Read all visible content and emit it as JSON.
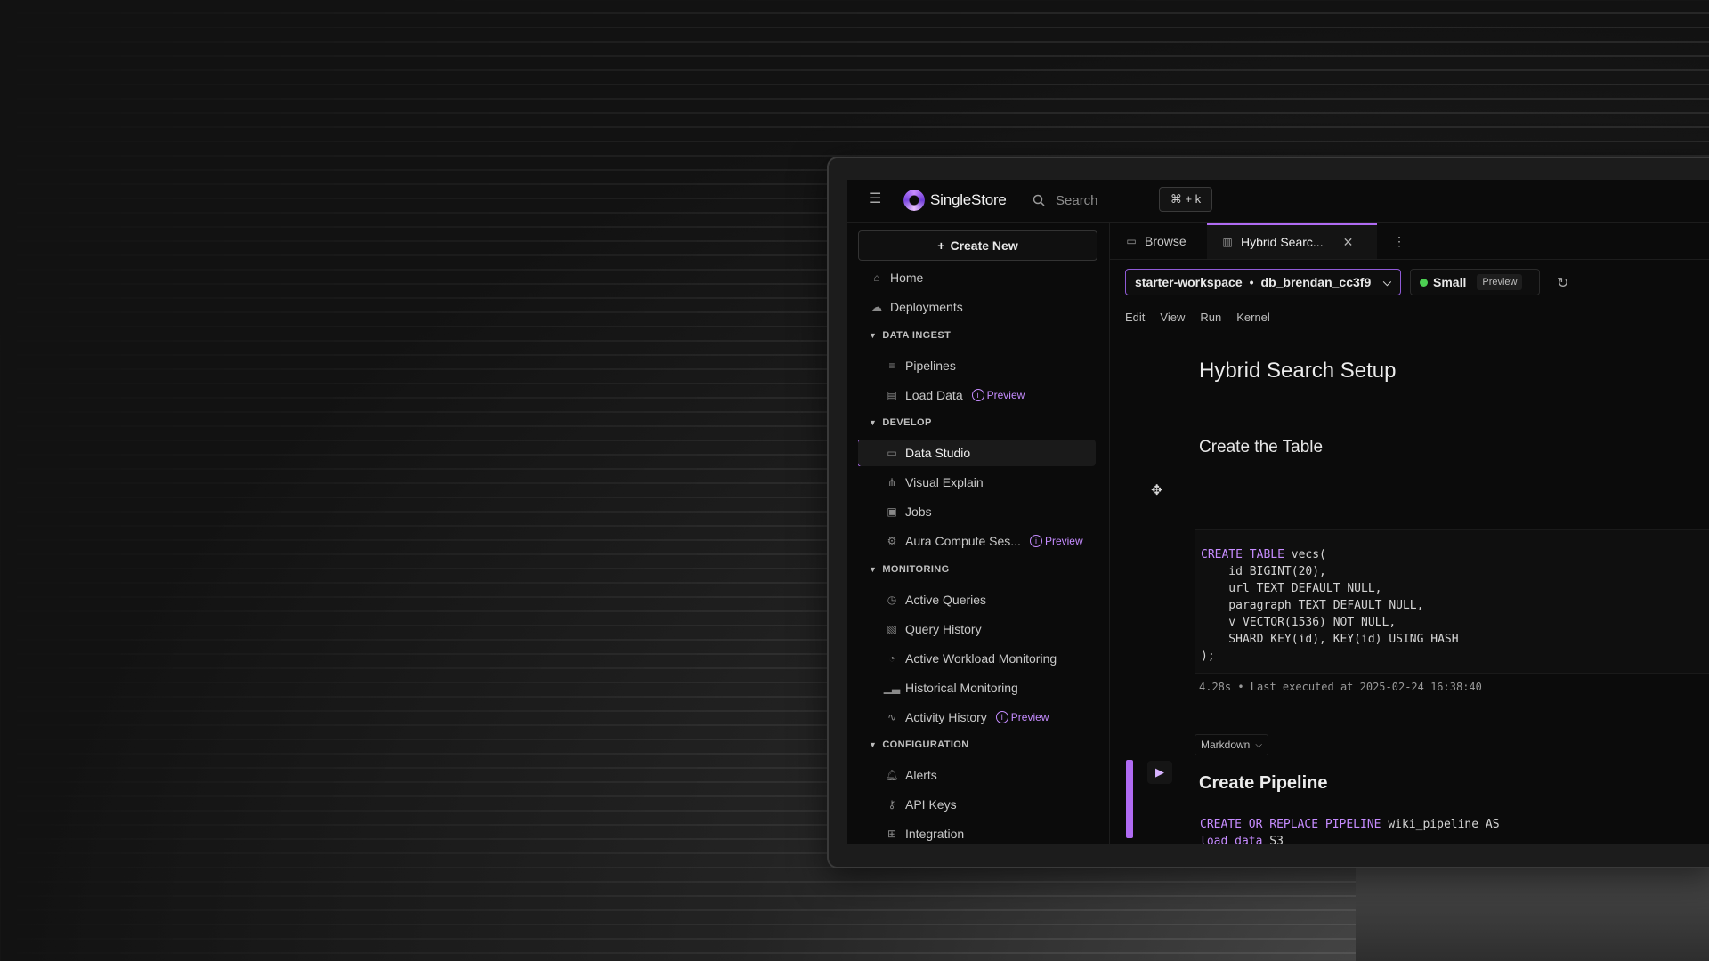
{
  "app": {
    "brand": "SingleStore",
    "search_placeholder": "Search",
    "search_shortcut": "⌘ + k"
  },
  "sidebar": {
    "create_new": "Create New",
    "items_top": [
      {
        "label": "Home",
        "icon": "home-icon"
      },
      {
        "label": "Deployments",
        "icon": "cloud-icon"
      }
    ],
    "sections": {
      "data_ingest": "DATA INGEST",
      "develop": "DEVELOP",
      "monitoring": "MONITORING",
      "configuration": "CONFIGURATION"
    },
    "data_ingest_items": [
      {
        "label": "Pipelines"
      },
      {
        "label": "Load Data",
        "badge": "Preview"
      }
    ],
    "develop_items": [
      {
        "label": "Data Studio",
        "active": true
      },
      {
        "label": "Visual Explain"
      },
      {
        "label": "Jobs"
      },
      {
        "label": "Aura Compute Ses...",
        "badge": "Preview"
      }
    ],
    "monitoring_items": [
      {
        "label": "Active Queries"
      },
      {
        "label": "Query History"
      },
      {
        "label": "Active Workload Monitoring"
      },
      {
        "label": "Historical Monitoring"
      },
      {
        "label": "Activity History",
        "badge": "Preview"
      }
    ],
    "configuration_items": [
      {
        "label": "Alerts"
      },
      {
        "label": "API Keys"
      },
      {
        "label": "Integration"
      }
    ]
  },
  "tabs": {
    "browse": "Browse",
    "notebook": "Hybrid Searc..."
  },
  "toolbar": {
    "workspace": "starter-workspace",
    "separator": "•",
    "database": "db_brendan_cc3f9",
    "size": "Small",
    "size_badge": "Preview",
    "menu": [
      "Edit",
      "View",
      "Run",
      "Kernel"
    ]
  },
  "notebook": {
    "title": "Hybrid Search Setup",
    "section1": "Create the Table",
    "code1": {
      "kw": "CREATE TABLE",
      "line1_rest": " vecs(",
      "lines": [
        "    id BIGINT(20),",
        "    url TEXT DEFAULT NULL,",
        "    paragraph TEXT DEFAULT NULL,",
        "    v VECTOR(1536) NOT NULL,",
        "    SHARD KEY(id), KEY(id) USING HASH",
        ");"
      ]
    },
    "exec_info": "4.28s • Last executed at 2025-02-24 16:38:40",
    "cell_type": "Markdown",
    "section2": "Create Pipeline",
    "code2": {
      "kw": "CREATE OR REPLACE PIPELINE",
      "line1_rest": " wiki_pipeline AS",
      "kw2": "load data",
      "line2_rest": " S3"
    }
  },
  "colors": {
    "accent": "#b06bf3",
    "status_green": "#4ccf52",
    "preview_badge": "#c58cff"
  }
}
